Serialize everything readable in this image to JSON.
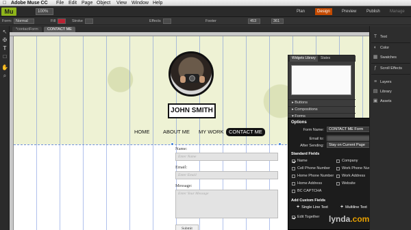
{
  "menubar": {
    "apple": "",
    "app_name": "Adobe Muse CC",
    "items": [
      "File",
      "Edit",
      "Page",
      "Object",
      "View",
      "Window",
      "Help"
    ]
  },
  "appbar": {
    "logo": "Mu",
    "zoom": "100%",
    "workspaces": [
      "Plan",
      "Design",
      "Preview",
      "Publish",
      "Manage"
    ],
    "active_workspace": "Design"
  },
  "controlbar": {
    "form_label": "Form:",
    "form_value": "Normal",
    "fill_label": "Fill",
    "stroke_label": "Stroke",
    "effects_label": "Effects",
    "footer_label": "Footer",
    "x_value": "453",
    "y_value": "361"
  },
  "tabs": [
    "*contactForm",
    "CONTACT ME"
  ],
  "page": {
    "name": "JOHN SMITH",
    "nav": [
      "HOME",
      "ABOUT ME",
      "MY WORK",
      "CONTACT ME"
    ],
    "active_nav": "CONTACT ME",
    "form": {
      "name_label": "Name:",
      "name_placeholder": "Enter Name",
      "email_label": "Email:",
      "email_placeholder": "Enter Email",
      "message_label": "Message:",
      "message_placeholder": "Enter Your Message",
      "submit_label": "Submit"
    }
  },
  "floatpanel": {
    "tabs": [
      "Widgets Library",
      "States"
    ],
    "rows": [
      "Buttons",
      "Compositions",
      "Forms"
    ]
  },
  "options": {
    "title": "Options",
    "form_name_label": "Form Name:",
    "form_name_value": "CONTACT ME Form",
    "email_to_label": "Email to:",
    "after_sending_label": "After Sending:",
    "after_sending_value": "Stay on Current Page",
    "standard_fields_label": "Standard Fields",
    "fields": [
      {
        "label": "Name",
        "checked": true
      },
      {
        "label": "Company",
        "checked": false
      },
      {
        "label": "Cell Phone Number",
        "checked": false
      },
      {
        "label": "Work Phone Number",
        "checked": false
      },
      {
        "label": "Home Phone Number",
        "checked": false
      },
      {
        "label": "Work Address",
        "checked": false
      },
      {
        "label": "Home Address",
        "checked": false
      },
      {
        "label": "Website",
        "checked": false
      },
      {
        "label": "BC CAPTCHA",
        "checked": false
      }
    ],
    "add_custom_label": "Add Custom Fields",
    "single_line": "Single Line Text",
    "multi_line": "Multiline Text",
    "edit_together": "Edit Together"
  },
  "dock": [
    "Text",
    "Color",
    "Swatches",
    "Scroll Effects",
    "Layers",
    "Library",
    "Assets"
  ],
  "watermark": {
    "pre": "lynda",
    "post": ".com"
  }
}
